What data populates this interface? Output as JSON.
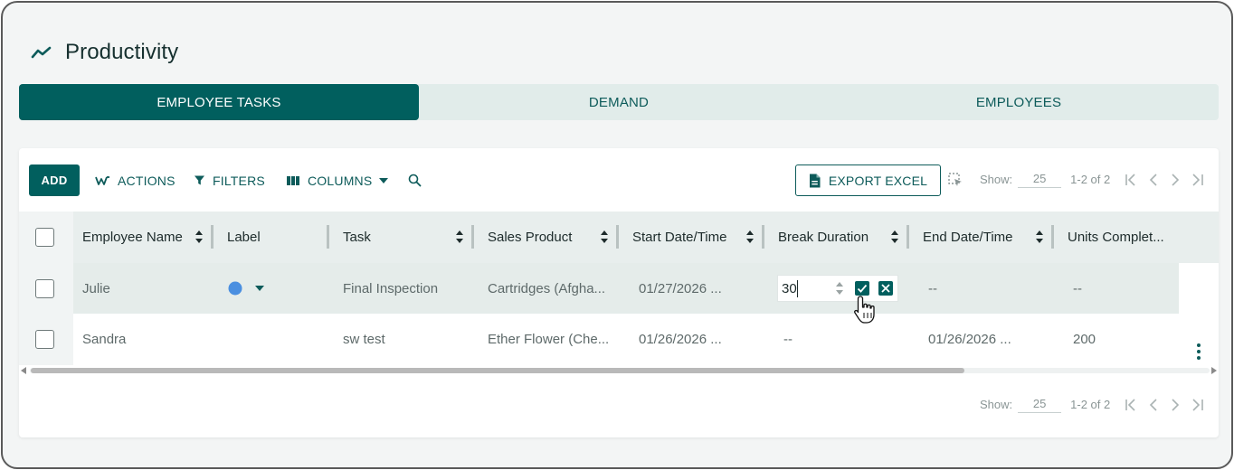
{
  "page": {
    "title": "Productivity",
    "title_icon": "trending-up-icon"
  },
  "tabs": [
    {
      "label": "EMPLOYEE TASKS",
      "active": true
    },
    {
      "label": "DEMAND",
      "active": false
    },
    {
      "label": "EMPLOYEES",
      "active": false
    }
  ],
  "toolbar": {
    "add_label": "ADD",
    "actions_label": "ACTIONS",
    "filters_label": "FILTERS",
    "columns_label": "COLUMNS",
    "export_label": "EXPORT EXCEL",
    "show_label": "Show:",
    "page_size": "25",
    "range": "1-2 of 2"
  },
  "footer": {
    "show_label": "Show:",
    "page_size": "25",
    "range": "1-2 of 2"
  },
  "columns": [
    "Employee Name",
    "Label",
    "Task",
    "Sales Product",
    "Start Date/Time",
    "Break Duration",
    "End Date/Time",
    "Units Complet..."
  ],
  "rows": [
    {
      "employee": "Julie",
      "label_color": "#4a8fe0",
      "task": "Final Inspection",
      "sales_product": "Cartridges (Afgha...",
      "start": "01/27/2026 ...",
      "break_duration": "30",
      "end": "--",
      "units": "--"
    },
    {
      "employee": "Sandra",
      "task": "sw test",
      "sales_product": "Ether Flower (Che...",
      "start": "01/26/2026 ...",
      "break_duration": "--",
      "end": "01/26/2026 ...",
      "units": "200"
    }
  ],
  "colors": {
    "accent": "#015f5e",
    "tab_bg": "#e1ecea",
    "selected_row": "#e5ecea"
  }
}
